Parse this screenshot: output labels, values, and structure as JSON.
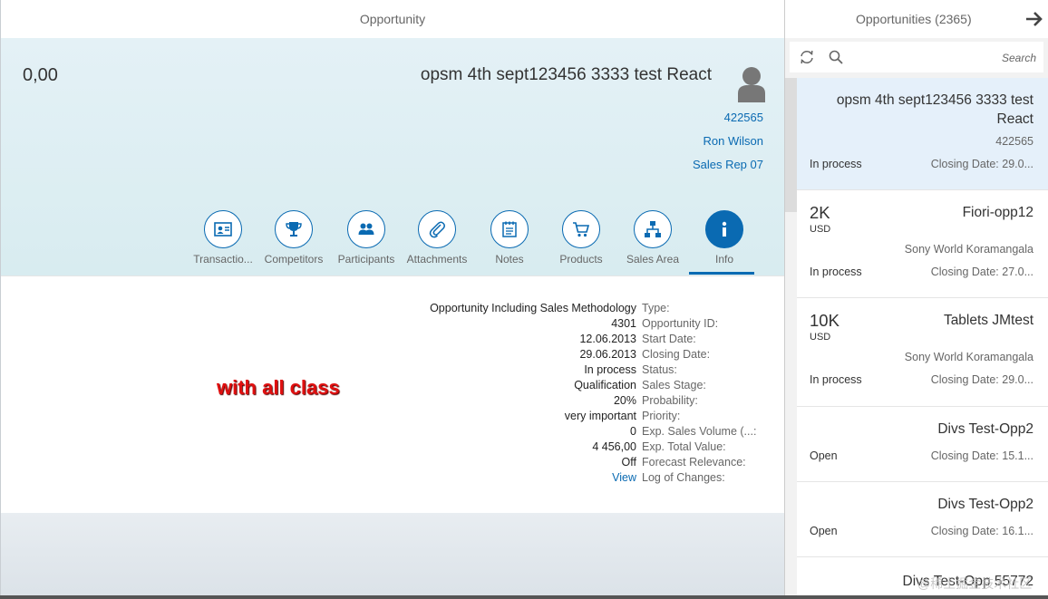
{
  "detail": {
    "header_title": "Opportunity",
    "object": {
      "number": "0,00",
      "title": "opsm 4th sept123456 3333 test React",
      "avatar_icon": "person-icon",
      "attributes": [
        "422565",
        "Ron Wilson",
        "Sales Rep 07"
      ]
    },
    "tabs": [
      {
        "label": "Transactio...",
        "icon": "contact-card-icon"
      },
      {
        "label": "Competitors",
        "icon": "trophy-icon"
      },
      {
        "label": "Participants",
        "icon": "group-icon"
      },
      {
        "label": "Attachments",
        "icon": "paperclip-icon"
      },
      {
        "label": "Notes",
        "icon": "notes-icon"
      },
      {
        "label": "Products",
        "icon": "cart-icon"
      },
      {
        "label": "Sales Area",
        "icon": "org-chart-icon"
      },
      {
        "label": "Info",
        "icon": "info-icon",
        "active": true
      }
    ],
    "info_rows": [
      {
        "label": "Type:",
        "value": "Opportunity Including Sales Methodology"
      },
      {
        "label": "Opportunity ID:",
        "value": "4301"
      },
      {
        "label": "Start Date:",
        "value": "12.06.2013"
      },
      {
        "label": "Closing Date:",
        "value": "29.06.2013"
      },
      {
        "label": "Status:",
        "value": "In process"
      },
      {
        "label": "Sales Stage:",
        "value": "Qualification"
      },
      {
        "label": "Probability:",
        "value": "20%"
      },
      {
        "label": "Priority:",
        "value": "very important"
      },
      {
        "label": "Exp. Sales Volume (...:",
        "value": "0"
      },
      {
        "label": "Exp. Total Value:",
        "value": "4 456,00"
      },
      {
        "label": "Forecast Relevance:",
        "value": "Off"
      },
      {
        "label": "Log of Changes:",
        "value": "View",
        "link": true
      }
    ],
    "annotation": "with all class"
  },
  "master": {
    "title": "Opportunities (2365)",
    "search_placeholder": "Search",
    "items": [
      {
        "title": "opsm 4th sept123456 3333 test React",
        "attribute": "422565",
        "status": "In process",
        "date": "Closing Date: 29.0...",
        "selected": true
      },
      {
        "number": "2K",
        "unit": "USD",
        "title": "Fiori-opp12",
        "attribute": "Sony World Koramangala",
        "status": "In process",
        "date": "Closing Date: 27.0..."
      },
      {
        "number": "10K",
        "unit": "USD",
        "title": "Tablets JMtest",
        "attribute": "Sony World Koramangala",
        "status": "In process",
        "date": "Closing Date: 29.0..."
      },
      {
        "title": "Divs Test-Opp2",
        "status": "Open",
        "date": "Closing Date: 15.1..."
      },
      {
        "title": "Divs Test-Opp2",
        "status": "Open",
        "date": "Closing Date: 16.1..."
      },
      {
        "title": "Divs Test-Opp 55772"
      }
    ]
  },
  "watermark": "@稀土掘金技术社区",
  "colors": {
    "accent": "#0a6ab2",
    "annotation": "#e01010",
    "selected": "#e5f0fa"
  }
}
